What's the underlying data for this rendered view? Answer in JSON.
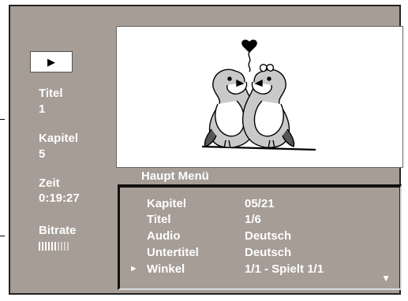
{
  "player": {
    "play_symbol": "▶",
    "title_label": "Titel",
    "title_value": "1",
    "chapter_label": "Kapitel",
    "chapter_value": "5",
    "time_label": "Zeit",
    "time_value": "0:19:27",
    "bitrate_label": "Bitrate",
    "bitrate_level": 0.6
  },
  "video": {
    "content": "two-doves-illustration"
  },
  "menu": {
    "title": "Haupt Menü",
    "items": [
      {
        "label": "Kapitel",
        "value": "05/21"
      },
      {
        "label": "Titel",
        "value": "1/6"
      },
      {
        "label": "Audio",
        "value": "Deutsch"
      },
      {
        "label": "Untertitel",
        "value": "Deutsch"
      },
      {
        "label": "Winkel",
        "value": "1/1 - Spielt 1/1"
      }
    ],
    "selected_index": 4,
    "selected_marker": "►",
    "scroll_marker": "▼"
  },
  "colors": {
    "screen": "#a59d96",
    "text": "#ffffff",
    "frame": "#222222"
  }
}
